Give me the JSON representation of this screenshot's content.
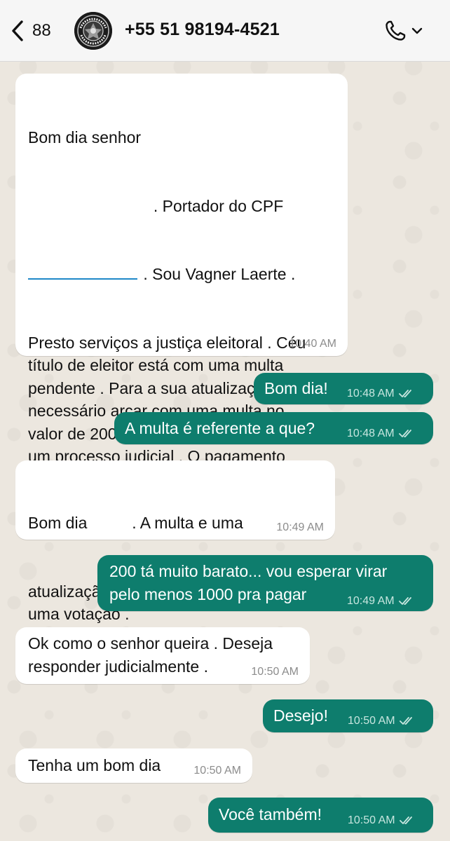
{
  "header": {
    "back_count": "88",
    "contact": "+55 51 98194-4521",
    "avatar_icon": "justica-eleitoral-seal-icon",
    "call_icon": "phone-icon"
  },
  "messages": [
    {
      "text_line1": "Bom dia senhor",
      "text_line2": ". Portador do CPF",
      "text_line3": ". Sou Vagner Laerte .",
      "text_rest": "Presto serviços a justiça eleitoral . Céu\ntítulo de eleitor está com uma multa\npendente . Para a sua atualização e\nnecessário arcar com uma multa no\nvalor de 200 . Reais ,  ou responderá a\num processo judicial . O pagamento\npode ser feito via Pix . estamos no\naguardo . Obrigado por sua atenção ..",
      "time": "10:40 AM"
    },
    {
      "text": "Bom dia!",
      "time": "10:48 AM"
    },
    {
      "text": "A multa é referente a que?",
      "time": "10:48 AM"
    },
    {
      "text_a": "Bom dia",
      "text_b": ". A multa e uma",
      "text_rest": "atualização deferente a um atraso de\numa votação .",
      "time": "10:49 AM"
    },
    {
      "text": "200 tá muito barato... vou esperar virar\npelo menos 1000 pra pagar",
      "time": "10:49 AM"
    },
    {
      "text": "Ok como o senhor queira . Deseja\nresponder judicialmente .",
      "time": "10:50 AM"
    },
    {
      "text": "Desejo!",
      "time": "10:50 AM"
    },
    {
      "text": "Tenha um bom dia",
      "time": "10:50 AM"
    },
    {
      "text": "Você também!",
      "time": "10:50 AM"
    }
  ],
  "colors": {
    "outgoing_bubble": "#0e7d6d",
    "incoming_bubble": "#ffffff",
    "wallpaper": "#ece7df"
  },
  "icons": {
    "read_receipt": "double-check-icon",
    "back": "chevron-left-icon",
    "dropdown": "chevron-down-icon"
  }
}
